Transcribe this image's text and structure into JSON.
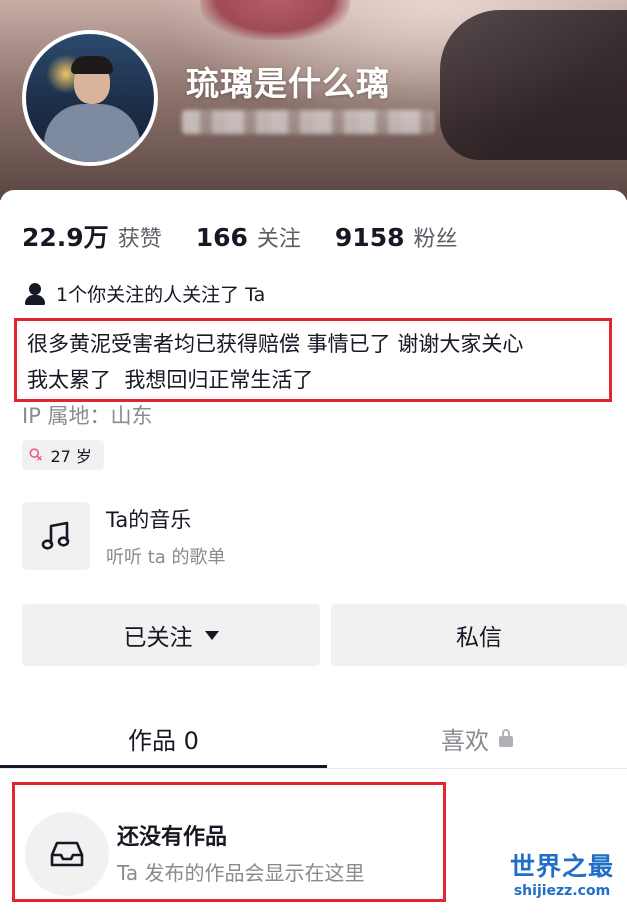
{
  "profile": {
    "username": "琉璃是什么璃"
  },
  "stats": [
    {
      "value": "22.9万",
      "label": "获赞"
    },
    {
      "value": "166",
      "label": "关注"
    },
    {
      "value": "9158",
      "label": "粉丝"
    }
  ],
  "mutual": {
    "text": "1个你关注的人关注了 Ta",
    "icon": "person-icon"
  },
  "bio": {
    "line1": "很多黄泥受害者均已获得赔偿 事情已了 谢谢大家关心",
    "line2": "我太累了  我想回归正常生活了"
  },
  "ip_location": "IP 属地：山东",
  "age_tag": {
    "icon": "female-icon",
    "icon_glyph": "♀",
    "text": "27 岁"
  },
  "music": {
    "icon": "music-note-icon",
    "title": "Ta的音乐",
    "subtitle": "听听 ta 的歌单"
  },
  "buttons": {
    "follow_label": "已关注",
    "message_label": "私信"
  },
  "tabs": [
    {
      "label": "作品 0",
      "active": true
    },
    {
      "label": "喜欢",
      "active": false,
      "icon": "lock-icon"
    }
  ],
  "empty_state": {
    "icon": "inbox-icon",
    "title": "还没有作品",
    "description": "Ta 发布的作品会显示在这里"
  },
  "watermark": {
    "title": "世界之最",
    "url": "shijiezz.com"
  },
  "colors": {
    "annotation_border": "#e3262d",
    "female_accent": "#f0508c",
    "watermark": "#1f6fc9"
  }
}
